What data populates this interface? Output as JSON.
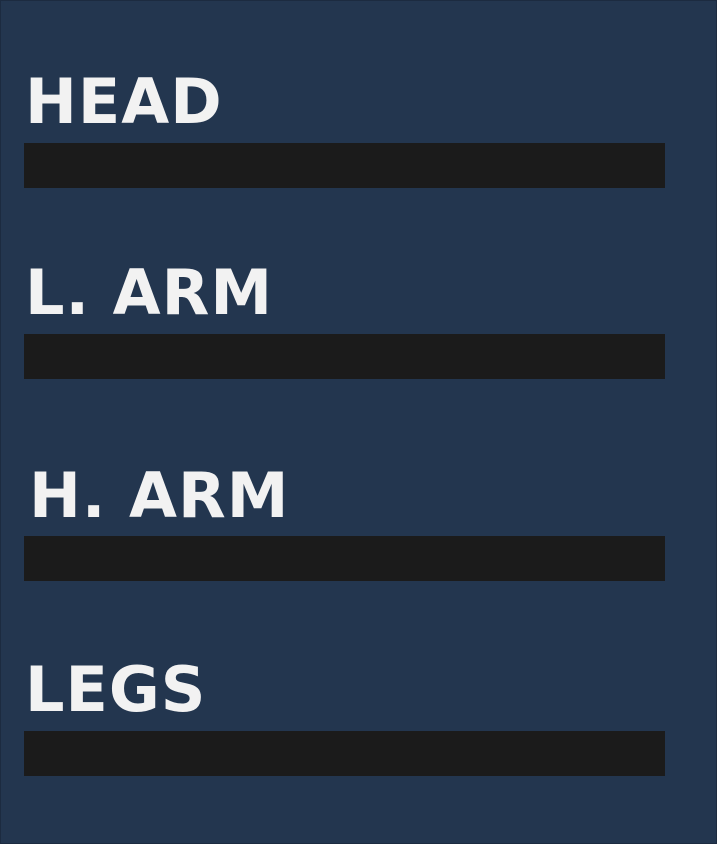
{
  "body_parts": [
    {
      "label": "HEAD",
      "health_fraction": 0
    },
    {
      "label": "L. ARM",
      "health_fraction": 0
    },
    {
      "label": "H. ARM",
      "health_fraction": 0
    },
    {
      "label": "LEGS",
      "health_fraction": 0
    }
  ],
  "colors": {
    "background": "#23364f",
    "bar_empty": "#1b1b1b",
    "label_text": "#f2f2f2"
  }
}
